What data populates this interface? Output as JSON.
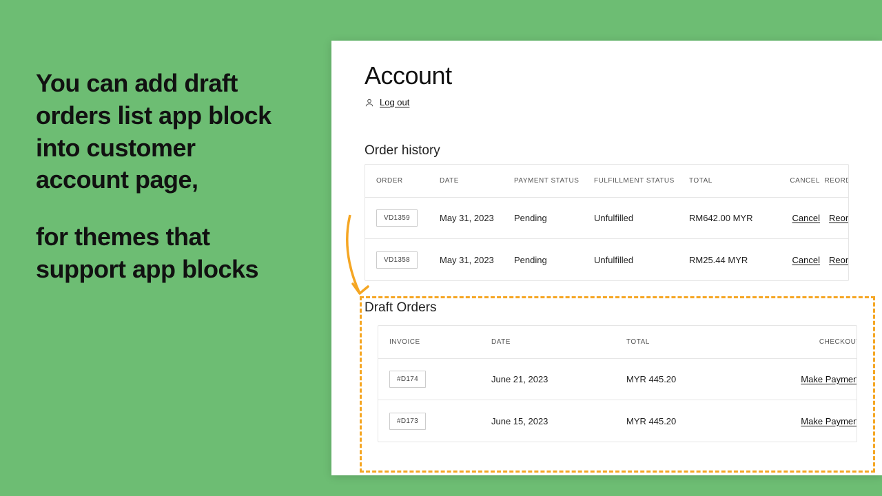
{
  "promo": {
    "line1": "You can add draft orders list app block into customer account page,",
    "line2": "for themes that support app blocks"
  },
  "account": {
    "title": "Account",
    "logout": "Log out"
  },
  "order_history": {
    "title": "Order history",
    "headers": {
      "order": "ORDER",
      "date": "DATE",
      "payment": "PAYMENT STATUS",
      "fulfillment": "FULFILLMENT STATUS",
      "total": "TOTAL",
      "cancel": "CANCEL",
      "reorder": "REORDER"
    },
    "rows": [
      {
        "order": "VD1359",
        "date": "May 31, 2023",
        "payment": "Pending",
        "fulfillment": "Unfulfilled",
        "total": "RM642.00 MYR",
        "cancel": "Cancel",
        "reorder": "Reorder"
      },
      {
        "order": "VD1358",
        "date": "May 31, 2023",
        "payment": "Pending",
        "fulfillment": "Unfulfilled",
        "total": "RM25.44 MYR",
        "cancel": "Cancel",
        "reorder": "Reorder"
      }
    ]
  },
  "draft_orders": {
    "title": "Draft Orders",
    "headers": {
      "invoice": "INVOICE",
      "date": "DATE",
      "total": "TOTAL",
      "checkout": "CHECKOUT"
    },
    "rows": [
      {
        "invoice": "#D174",
        "date": "June 21, 2023",
        "total": "MYR 445.20",
        "checkout": "Make Payment"
      },
      {
        "invoice": "#D173",
        "date": "June 15, 2023",
        "total": "MYR 445.20",
        "checkout": "Make Payment"
      }
    ]
  }
}
